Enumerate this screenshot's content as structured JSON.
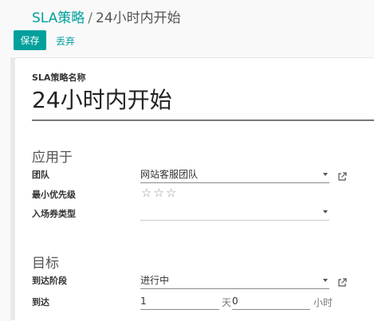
{
  "breadcrumb": {
    "parent": "SLA策略",
    "separator": "/",
    "current": "24小时内开始"
  },
  "toolbar": {
    "save_label": "保存",
    "discard_label": "丢弃"
  },
  "form": {
    "name_label": "SLA策略名称",
    "name_value": "24小时内开始",
    "apply_section": {
      "title": "应用于",
      "team_label": "团队",
      "team_value": "网站客服团队",
      "priority_label": "最小优先级",
      "priority_stars": 0,
      "priority_max": 3,
      "ticket_type_label": "入场券类型",
      "ticket_type_value": ""
    },
    "target_section": {
      "title": "目标",
      "stage_label": "到达阶段",
      "stage_value": "进行中",
      "reach_label": "到达",
      "days_value": "1",
      "days_unit": "天",
      "hours_value": "0",
      "hours_unit": "小时"
    }
  },
  "colors": {
    "accent": "#00a09d",
    "text": "#4c4c4c"
  },
  "icons": [
    "external-link-icon",
    "star-outline-icon",
    "caret-down-icon"
  ]
}
